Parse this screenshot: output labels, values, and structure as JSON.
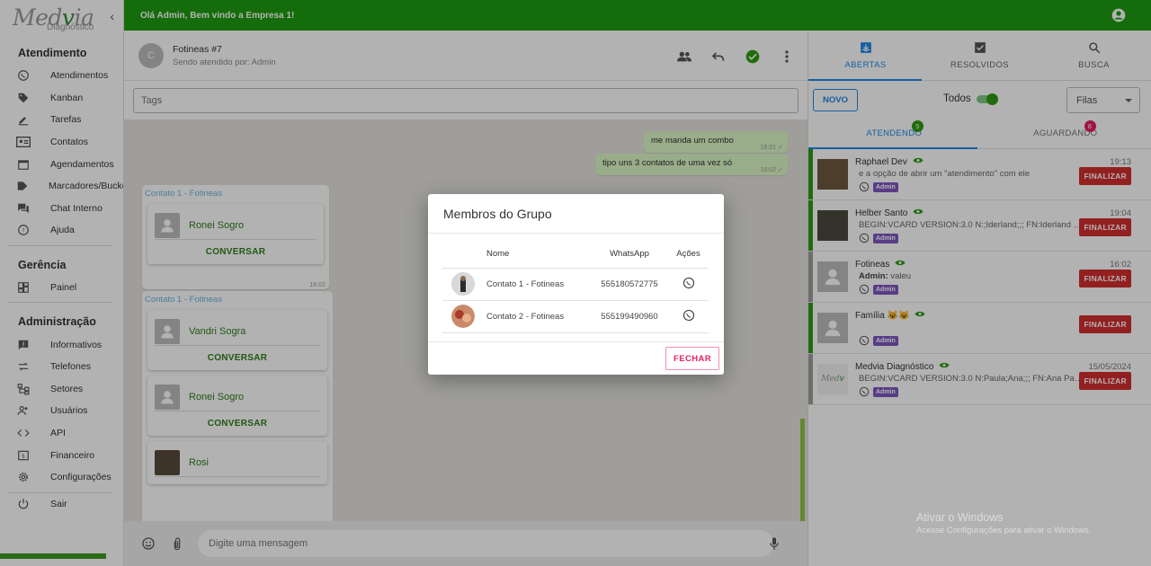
{
  "app": {
    "logo": "Medvia",
    "logo_sub": "Diagnóstico",
    "welcome": "Olá Admin, Bem vindo a Empresa 1!",
    "brand_color": "#1e9b0f"
  },
  "sidebar": {
    "sections": [
      {
        "title": "Atendimento",
        "items": [
          {
            "label": "Atendimentos",
            "icon": "whatsapp-icon"
          },
          {
            "label": "Kanban",
            "icon": "tag-icon"
          },
          {
            "label": "Tarefas",
            "icon": "pencil-icon"
          },
          {
            "label": "Contatos",
            "icon": "contacts-icon"
          },
          {
            "label": "Agendamentos",
            "icon": "calendar-icon"
          },
          {
            "label": "Marcadores/Buckets",
            "icon": "label-icon"
          },
          {
            "label": "Chat Interno",
            "icon": "forum-icon"
          },
          {
            "label": "Ajuda",
            "icon": "help-icon"
          }
        ]
      },
      {
        "title": "Gerência",
        "items": [
          {
            "label": "Painel",
            "icon": "dashboard-icon"
          }
        ]
      },
      {
        "title": "Administração",
        "items": [
          {
            "label": "Informativos",
            "icon": "announcement-icon"
          },
          {
            "label": "Telefones",
            "icon": "sync-arrows-icon"
          },
          {
            "label": "Setores",
            "icon": "tree-icon"
          },
          {
            "label": "Usuários",
            "icon": "people-icon"
          },
          {
            "label": "API",
            "icon": "code-icon"
          },
          {
            "label": "Financeiro",
            "icon": "money-icon"
          },
          {
            "label": "Configurações",
            "icon": "settings-icon"
          },
          {
            "label": "Sair",
            "icon": "logout-icon"
          }
        ]
      }
    ]
  },
  "chat": {
    "avatar_letter": "C",
    "title": "Fotineas #7",
    "subtitle": "Sendo atendido por: Admin",
    "tags_placeholder": "Tags",
    "composer_placeholder": "Digite uma mensagem",
    "outgoing": [
      {
        "text": "me manda um combo",
        "time": "16:01"
      },
      {
        "text": "tipo uns 3 contatos de uma vez só",
        "time": "16:02"
      }
    ],
    "incoming": [
      {
        "sender": "Contato 1 - Fotineas",
        "contact": "Ronei Sogro",
        "action": "CONVERSAR",
        "time": "16:02"
      },
      {
        "sender": "Contato 1 - Fotineas",
        "contact": "Vandri Sogra",
        "action": "CONVERSAR"
      },
      {
        "contact": "Ronei Sogro",
        "action": "CONVERSAR"
      },
      {
        "contact": "Rosi"
      }
    ]
  },
  "right": {
    "tabs": [
      {
        "label": "ABERTAS",
        "icon": "inbox-icon",
        "active": true
      },
      {
        "label": "RESOLVIDOS",
        "icon": "check-box-icon"
      },
      {
        "label": "BUSCA",
        "icon": "search-icon"
      }
    ],
    "novo": "NOVO",
    "todos": "Todos",
    "filas": "Filas",
    "subtabs": [
      {
        "label": "ATENDENDO",
        "badge": "5",
        "badge_color": "#2e9b12",
        "active": true
      },
      {
        "label": "AGUARDANDO",
        "badge": "8",
        "badge_color": "#e91e63"
      }
    ],
    "tickets": [
      {
        "name": "Raphael Dev",
        "preview": "e a opção de abrir um \"atendimento\" com ele",
        "time": "19:13",
        "tag": "Admin",
        "action": "FINALIZAR",
        "stripe": "#2e9b12",
        "avatar": "photo"
      },
      {
        "name": "Helber Santo",
        "preview": "BEGIN:VCARD VERSION:3.0 N:;Iderland;;; FN:Iderland TEL;type=CELL",
        "time": "19:04",
        "tag": "Admin",
        "action": "FINALIZAR",
        "stripe": "#2e9b12",
        "avatar": "photo"
      },
      {
        "name": "Fotineas",
        "preview_bold": "Admin:",
        "preview": " valeu",
        "time": "16:02",
        "tag": "Admin",
        "action": "FINALIZAR",
        "stripe": "#9e9e9e",
        "avatar": "default"
      },
      {
        "name": "Família 😺😺",
        "preview": "",
        "time": "",
        "tag": "Admin",
        "action": "FINALIZAR",
        "stripe": "#2e9b12",
        "avatar": "default"
      },
      {
        "name": "Medvia Diagnóstico",
        "preview": "BEGIN:VCARD VERSION:3.0 N:Paula;Ana;;; FN:Ana Paula TEL;type=CELL",
        "time": "15/05/2024",
        "tag": "Admin",
        "action": "FINALIZAR",
        "stripe": "#9e9e9e",
        "avatar": "logo"
      }
    ]
  },
  "modal": {
    "title": "Membros do Grupo",
    "columns": [
      "Nome",
      "WhatsApp",
      "Ações"
    ],
    "rows": [
      {
        "name": "Contato 1 - Fotineas",
        "whatsapp": "555180572775"
      },
      {
        "name": "Contato 2 - Fotineas",
        "whatsapp": "555199490960"
      }
    ],
    "close": "FECHAR"
  },
  "watermark": {
    "line1": "Ativar o Windows",
    "line2": "Acesse Configurações para ativar o Windows."
  }
}
